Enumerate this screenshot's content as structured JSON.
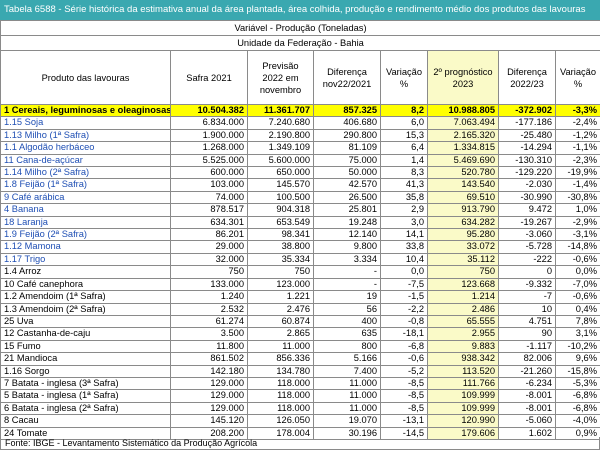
{
  "title": "Tabela 6588 - Série histórica da estimativa anual da área plantada, área colhida, produção e rendimento médio dos produtos das lavouras",
  "variable": "Variável - Produção (Toneladas)",
  "unit_row": "Unidade da Federação - Bahia",
  "columns": [
    "Produto das lavouras",
    "Safra 2021",
    "Previsão 2022 em novembro",
    "Diferença nov22/2021",
    "Variação %",
    "2º prognóstico 2023",
    "Diferença 2022/23",
    "Variação %"
  ],
  "rows": [
    [
      "1 Cereais, leguminosas e oleaginosas",
      "10.504.382",
      "11.361.707",
      "857.325",
      "8,2",
      "10.988.805",
      "-372.902",
      "-3,3%"
    ],
    [
      "1.15 Soja",
      "6.834.000",
      "7.240.680",
      "406.680",
      "6,0",
      "7.063.494",
      "-177.186",
      "-2,4%"
    ],
    [
      "1.13 Milho (1ª Safra)",
      "1.900.000",
      "2.190.800",
      "290.800",
      "15,3",
      "2.165.320",
      "-25.480",
      "-1,2%"
    ],
    [
      "1.1 Algodão herbáceo",
      "1.268.000",
      "1.349.109",
      "81.109",
      "6,4",
      "1.334.815",
      "-14.294",
      "-1,1%"
    ],
    [
      "11 Cana-de-açúcar",
      "5.525.000",
      "5.600.000",
      "75.000",
      "1,4",
      "5.469.690",
      "-130.310",
      "-2,3%"
    ],
    [
      "1.14 Milho (2ª Safra)",
      "600.000",
      "650.000",
      "50.000",
      "8,3",
      "520.780",
      "-129.220",
      "-19,9%"
    ],
    [
      "1.8 Feijão (1ª Safra)",
      "103.000",
      "145.570",
      "42.570",
      "41,3",
      "143.540",
      "-2.030",
      "-1,4%"
    ],
    [
      "9 Café arábica",
      "74.000",
      "100.500",
      "26.500",
      "35,8",
      "69.510",
      "-30.990",
      "-30,8%"
    ],
    [
      "4 Banana",
      "878.517",
      "904.318",
      "25.801",
      "2,9",
      "913.790",
      "9.472",
      "1,0%"
    ],
    [
      "18 Laranja",
      "634.301",
      "653.549",
      "19.248",
      "3,0",
      "634.282",
      "-19.267",
      "-2,9%"
    ],
    [
      "1.9 Feijão (2ª Safra)",
      "86.201",
      "98.341",
      "12.140",
      "14,1",
      "95.280",
      "-3.060",
      "-3,1%"
    ],
    [
      "1.12 Mamona",
      "29.000",
      "38.800",
      "9.800",
      "33,8",
      "33.072",
      "-5.728",
      "-14,8%"
    ],
    [
      "1.17 Trigo",
      "32.000",
      "35.334",
      "3.334",
      "10,4",
      "35.112",
      "-222",
      "-0,6%"
    ],
    [
      "1.4 Arroz",
      "750",
      "750",
      "-",
      "0,0",
      "750",
      "0",
      "0,0%"
    ],
    [
      "10 Café canephora",
      "133.000",
      "123.000",
      "-",
      "-7,5",
      "123.668",
      "-9.332",
      "-7,0%"
    ],
    [
      "1.2 Amendoim (1ª Safra)",
      "1.240",
      "1.221",
      "19",
      "-1,5",
      "1.214",
      "-7",
      "-0,6%"
    ],
    [
      "1.3 Amendoim (2ª Safra)",
      "2.532",
      "2.476",
      "56",
      "-2,2",
      "2.486",
      "10",
      "0,4%"
    ],
    [
      "25 Uva",
      "61.274",
      "60.874",
      "400",
      "-0,8",
      "65.555",
      "4.751",
      "7,8%"
    ],
    [
      "12 Castanha-de-caju",
      "3.500",
      "2.865",
      "635",
      "-18,1",
      "2.955",
      "90",
      "3,1%"
    ],
    [
      "15 Fumo",
      "11.800",
      "11.000",
      "800",
      "-6,8",
      "9.883",
      "-1.117",
      "-10,2%"
    ],
    [
      "21 Mandioca",
      "861.502",
      "856.336",
      "5.166",
      "-0,6",
      "938.342",
      "82.006",
      "9,6%"
    ],
    [
      "1.16 Sorgo",
      "142.180",
      "134.780",
      "7.400",
      "-5,2",
      "113.520",
      "-21.260",
      "-15,8%"
    ],
    [
      "7 Batata - inglesa (3ª Safra)",
      "129.000",
      "118.000",
      "11.000",
      "-8,5",
      "111.766",
      "-6.234",
      "-5,3%"
    ],
    [
      "5 Batata - inglesa (1ª Safra)",
      "129.000",
      "118.000",
      "11.000",
      "-8,5",
      "109.999",
      "-8.001",
      "-6,8%"
    ],
    [
      "6 Batata - inglesa (2ª Safra)",
      "129.000",
      "118.000",
      "11.000",
      "-8,5",
      "109.999",
      "-8.001",
      "-6,8%"
    ],
    [
      "8 Cacau",
      "145.120",
      "126.050",
      "19.070",
      "-13,1",
      "120.990",
      "-5.060",
      "-4,0%"
    ],
    [
      "24 Tomate",
      "208.200",
      "178.004",
      "30.196",
      "-14,5",
      "179.606",
      "1.602",
      "0,9%"
    ]
  ],
  "footer": "Fonte: IBGE - Levantamento Sistemático da Produção Agrícola",
  "colors": {
    "title_bg": "#3aa8b0",
    "highlight": "#ffff00",
    "forecast_bg": "#fafac8",
    "blue_text": "#1f4fb4"
  }
}
